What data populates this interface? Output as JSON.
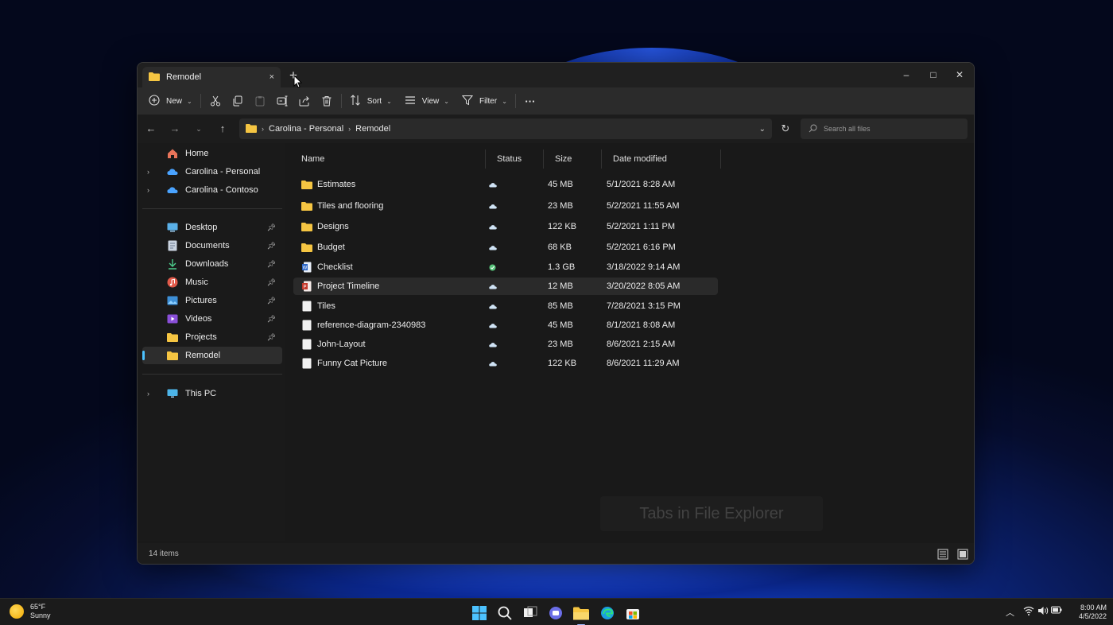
{
  "window": {
    "tab_title": "Remodel",
    "tab_close_glyph": "×",
    "new_tab_glyph": "+",
    "controls": {
      "minimize": "–",
      "maximize": "□",
      "close": "✕"
    }
  },
  "toolbar": {
    "new_label": "New",
    "sort_label": "Sort",
    "view_label": "View",
    "filter_label": "Filter",
    "more_glyph": "···",
    "icons": [
      "plus-circle-icon",
      "cut-icon",
      "copy-icon",
      "paste-icon",
      "rename-icon",
      "share-icon",
      "delete-icon"
    ]
  },
  "address": {
    "crumbs": [
      "Carolina - Personal",
      "Remodel"
    ],
    "search_placeholder": "Search all files"
  },
  "sidebar": {
    "top": [
      {
        "label": "Home",
        "icon": "home-icon",
        "expandable": false
      },
      {
        "label": "Carolina - Personal",
        "icon": "onedrive-icon",
        "expandable": true
      },
      {
        "label": "Carolina - Contoso",
        "icon": "onedrive-icon",
        "expandable": true
      }
    ],
    "quick": [
      {
        "label": "Desktop",
        "icon": "desktop-icon"
      },
      {
        "label": "Documents",
        "icon": "documents-icon"
      },
      {
        "label": "Downloads",
        "icon": "downloads-icon"
      },
      {
        "label": "Music",
        "icon": "music-icon"
      },
      {
        "label": "Pictures",
        "icon": "pictures-icon"
      },
      {
        "label": "Videos",
        "icon": "videos-icon"
      },
      {
        "label": "Projects",
        "icon": "folder-icon"
      },
      {
        "label": "Remodel",
        "icon": "folder-icon"
      }
    ],
    "this_pc": "This PC",
    "colors": {
      "accent": "#4cc2ff",
      "folder": "#f5c542",
      "onedrive": "#4aa3ff"
    }
  },
  "columns": {
    "name": "Name",
    "status": "Status",
    "size": "Size",
    "date": "Date modified"
  },
  "files": [
    {
      "name": "Estimates",
      "type": "folder",
      "status": "cloud",
      "size": "45 MB",
      "date": "5/1/2021 8:28 AM"
    },
    {
      "name": "Tiles and flooring",
      "type": "folder",
      "status": "cloud",
      "size": "23 MB",
      "date": "5/2/2021 11:55 AM"
    },
    {
      "name": "Designs",
      "type": "folder",
      "status": "cloud",
      "size": "122 KB",
      "date": "5/2/2021 1:11 PM"
    },
    {
      "name": "Budget",
      "type": "folder",
      "status": "cloud",
      "size": "68 KB",
      "date": "5/2/2021 6:16 PM"
    },
    {
      "name": "Checklist",
      "type": "word",
      "status": "synced",
      "size": "1.3 GB",
      "date": "3/18/2022 9:14 AM"
    },
    {
      "name": "Project Timeline",
      "type": "pdf",
      "status": "cloud",
      "size": "12 MB",
      "date": "3/20/2022 8:05 AM"
    },
    {
      "name": "Tiles",
      "type": "file",
      "status": "cloud",
      "size": "85 MB",
      "date": "7/28/2021 3:15 PM"
    },
    {
      "name": "reference-diagram-2340983",
      "type": "file",
      "status": "cloud",
      "size": "45 MB",
      "date": "8/1/2021 8:08 AM"
    },
    {
      "name": "John-Layout",
      "type": "file",
      "status": "cloud",
      "size": "23 MB",
      "date": "8/6/2021 2:15 AM"
    },
    {
      "name": "Funny Cat Picture",
      "type": "file",
      "status": "cloud",
      "size": "122 KB",
      "date": "8/6/2021 11:29 AM"
    }
  ],
  "toast_text": "Tabs in File Explorer",
  "status": {
    "item_count": "14 items"
  },
  "taskbar": {
    "weather_temp": "65°F",
    "weather_cond": "Sunny",
    "time": "8:00 AM",
    "date": "4/5/2022",
    "apps": [
      "start-icon",
      "search-icon",
      "task-view-icon",
      "chat-icon",
      "file-explorer-icon",
      "edge-icon",
      "store-icon"
    ]
  }
}
